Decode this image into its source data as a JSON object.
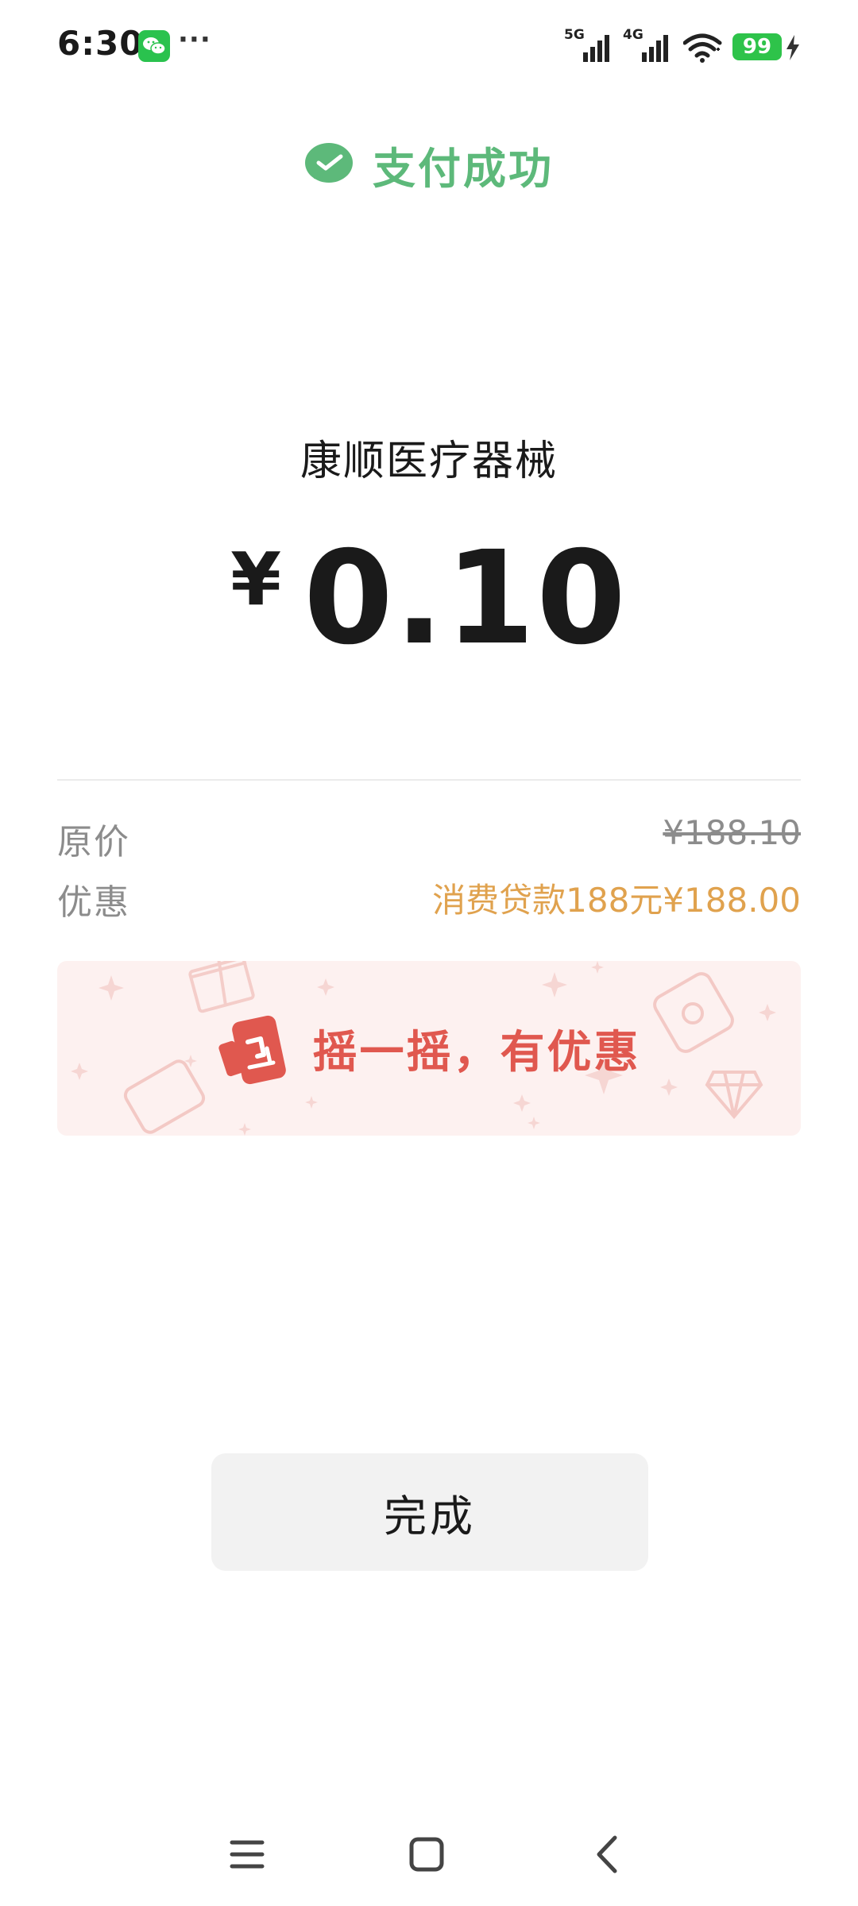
{
  "status_bar": {
    "time": "6:30",
    "notification_icon": "wechat-icon",
    "more_indicator": "···",
    "signal_1_label": "5G",
    "signal_2_label": "4G",
    "battery": "99",
    "icons": [
      "signal-5g-icon",
      "signal-4g-icon",
      "wifi-icon",
      "battery-icon",
      "charging-icon"
    ]
  },
  "header": {
    "icon": "wechat-pay-check-icon",
    "title": "支付成功"
  },
  "payment": {
    "merchant": "康顺医疗器械",
    "currency_symbol": "¥",
    "amount": "0.10"
  },
  "details": {
    "original_price_label": "原价",
    "original_price_value": "¥188.10",
    "discount_label": "优惠",
    "discount_value": "消费贷款188元¥188.00"
  },
  "banner": {
    "icon": "shake-phone-icon",
    "text": "摇一摇，有优惠"
  },
  "done_button": {
    "label": "完成"
  },
  "nav_bar": {
    "icons": [
      "menu-icon",
      "home-icon",
      "back-icon"
    ]
  },
  "colors": {
    "success_green": "#5db97a",
    "discount_orange": "#e0a24e",
    "banner_red": "#e0584f",
    "banner_bg": "#fdf1f0",
    "button_bg": "#f2f2f2"
  }
}
